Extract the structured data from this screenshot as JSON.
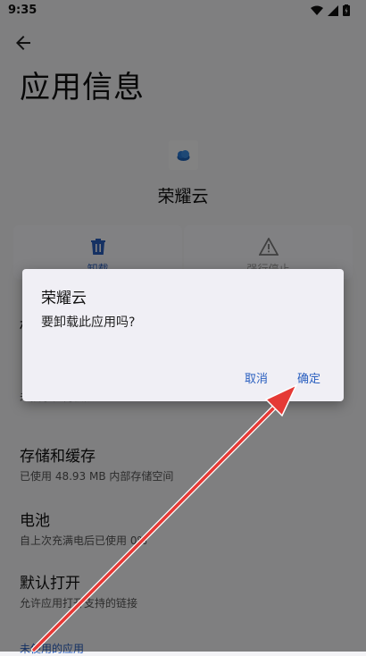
{
  "status_bar": {
    "time": "9:35"
  },
  "page": {
    "title": "应用信息"
  },
  "app": {
    "name": "荣耀云"
  },
  "actions": [
    {
      "label": "卸载"
    },
    {
      "label": "强行停止"
    }
  ],
  "rows": [
    {
      "title": "权限",
      "subtitle": "未授予任何权限"
    },
    {
      "title": "存储和缓存",
      "subtitle": "已使用 48.93 MB 内部存储空间"
    },
    {
      "title": "电池",
      "subtitle": "自上次充满电后已使用 0%"
    },
    {
      "title": "默认打开",
      "subtitle": "允许应用打开支持的链接"
    },
    {
      "title": "",
      "subtitle": "未使用的应用"
    }
  ],
  "dialog": {
    "title": "荣耀云",
    "message": "要卸载此应用吗?",
    "cancel_label": "取消",
    "ok_label": "确定"
  },
  "colors": {
    "accent": "#2a5fbf",
    "annotation_arrow": "#e53935"
  }
}
